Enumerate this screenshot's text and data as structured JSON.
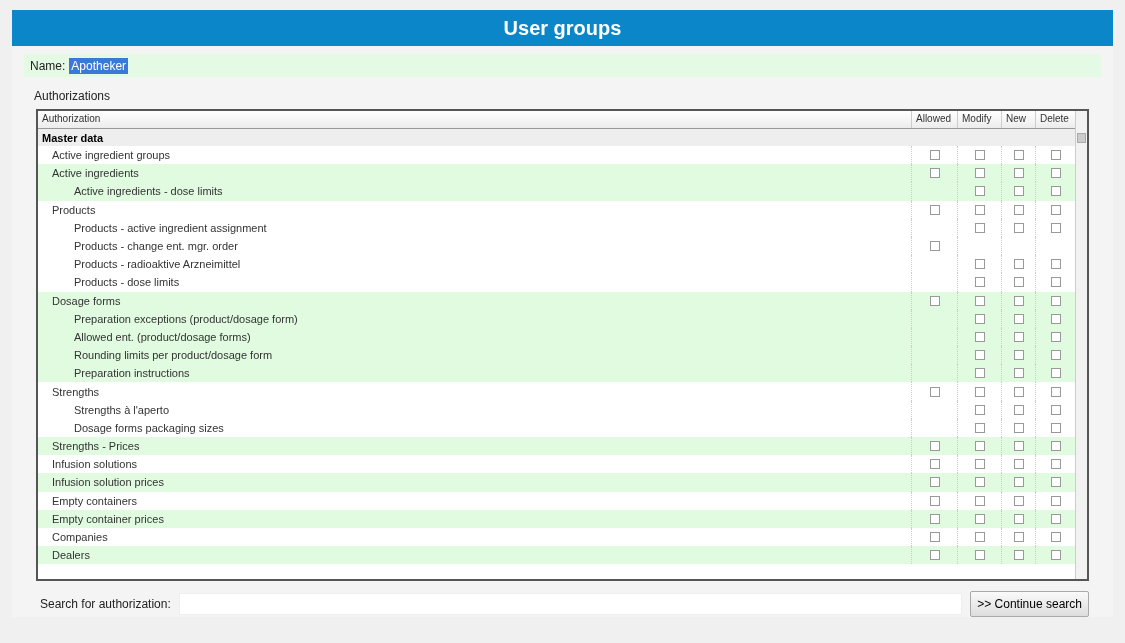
{
  "title": "User groups",
  "name_field": {
    "label": "Name:",
    "value": "Apotheker"
  },
  "section_label": "Authorizations",
  "table": {
    "columns": [
      "Authorization",
      "Allowed",
      "Modify",
      "New",
      "Delete"
    ],
    "group": "Master data",
    "rows": [
      {
        "label": "Active ingredient groups",
        "checks": {
          "allowed": {
            "checked": false
          },
          "modify": {
            "checked": false
          },
          "new": {
            "checked": false
          },
          "delete": {
            "checked": false
          }
        }
      },
      {
        "label": "Active ingredients",
        "checks": {
          "allowed": {
            "checked": false
          },
          "modify": {
            "checked": false
          },
          "new": {
            "checked": false
          },
          "delete": {
            "checked": false
          }
        },
        "children": [
          {
            "label": "Active ingredients - dose limits",
            "checks": {
              "modify": {
                "checked": false
              },
              "new": {
                "checked": false
              },
              "delete": {
                "checked": false
              }
            }
          }
        ]
      },
      {
        "label": "Products",
        "checks": {
          "allowed": {
            "checked": false
          },
          "modify": {
            "checked": false
          },
          "new": {
            "checked": false
          },
          "delete": {
            "checked": false
          }
        },
        "children": [
          {
            "label": "Products - active ingredient assignment",
            "checks": {
              "modify": {
                "checked": false
              },
              "new": {
                "checked": false
              },
              "delete": {
                "checked": false
              }
            }
          },
          {
            "label": "Products - change ent. mgr. order",
            "checks": {
              "allowed": {
                "checked": false
              }
            }
          },
          {
            "label": "Products - radioaktive Arzneimittel",
            "checks": {
              "modify": {
                "checked": false
              },
              "new": {
                "checked": false
              },
              "delete": {
                "checked": false
              }
            }
          },
          {
            "label": "Products - dose limits",
            "checks": {
              "modify": {
                "checked": false
              },
              "new": {
                "checked": false
              },
              "delete": {
                "checked": false
              }
            }
          }
        ]
      },
      {
        "label": "Dosage forms",
        "checks": {
          "allowed": {
            "checked": false
          },
          "modify": {
            "checked": false
          },
          "new": {
            "checked": false
          },
          "delete": {
            "checked": false
          }
        },
        "children": [
          {
            "label": "Preparation exceptions (product/dosage form)",
            "checks": {
              "modify": {
                "checked": false
              },
              "new": {
                "checked": false
              },
              "delete": {
                "checked": false
              }
            }
          },
          {
            "label": "Allowed ent. (product/dosage forms)",
            "checks": {
              "modify": {
                "checked": false
              },
              "new": {
                "checked": false
              },
              "delete": {
                "checked": false
              }
            }
          },
          {
            "label": "Rounding limits per product/dosage form",
            "checks": {
              "modify": {
                "checked": false
              },
              "new": {
                "checked": false
              },
              "delete": {
                "checked": false
              }
            }
          },
          {
            "label": "Preparation instructions",
            "checks": {
              "modify": {
                "checked": false
              },
              "new": {
                "checked": false
              },
              "delete": {
                "checked": false
              }
            }
          }
        ]
      },
      {
        "label": "Strengths",
        "checks": {
          "allowed": {
            "checked": false
          },
          "modify": {
            "checked": false
          },
          "new": {
            "checked": false
          },
          "delete": {
            "checked": false
          }
        },
        "children": [
          {
            "label": "Strengths à l'aperto",
            "checks": {
              "modify": {
                "checked": false
              },
              "new": {
                "checked": false
              },
              "delete": {
                "checked": false
              }
            }
          },
          {
            "label": "Dosage forms packaging sizes",
            "checks": {
              "modify": {
                "checked": false
              },
              "new": {
                "checked": false
              },
              "delete": {
                "checked": false
              }
            }
          }
        ]
      },
      {
        "label": "Strengths - Prices",
        "checks": {
          "allowed": {
            "checked": false
          },
          "modify": {
            "checked": false
          },
          "new": {
            "checked": false
          },
          "delete": {
            "checked": false
          }
        }
      },
      {
        "label": "Infusion solutions",
        "checks": {
          "allowed": {
            "checked": false
          },
          "modify": {
            "checked": false
          },
          "new": {
            "checked": false
          },
          "delete": {
            "checked": false
          }
        }
      },
      {
        "label": "Infusion solution prices",
        "checks": {
          "allowed": {
            "checked": false
          },
          "modify": {
            "checked": false
          },
          "new": {
            "checked": false
          },
          "delete": {
            "checked": false
          }
        }
      },
      {
        "label": "Empty containers",
        "checks": {
          "allowed": {
            "checked": false
          },
          "modify": {
            "checked": false
          },
          "new": {
            "checked": false
          },
          "delete": {
            "checked": false
          }
        }
      },
      {
        "label": "Empty container prices",
        "checks": {
          "allowed": {
            "checked": false
          },
          "modify": {
            "checked": false
          },
          "new": {
            "checked": false
          },
          "delete": {
            "checked": false
          }
        }
      },
      {
        "label": "Companies",
        "checks": {
          "allowed": {
            "checked": false
          },
          "modify": {
            "checked": false
          },
          "new": {
            "checked": false
          },
          "delete": {
            "checked": false
          }
        }
      },
      {
        "label": "Dealers",
        "checks": {
          "allowed": {
            "checked": false
          },
          "modify": {
            "checked": false
          },
          "new": {
            "checked": false
          },
          "delete": {
            "checked": false
          }
        }
      }
    ]
  },
  "search": {
    "label": "Search for authorization:",
    "button": ">> Continue search"
  }
}
